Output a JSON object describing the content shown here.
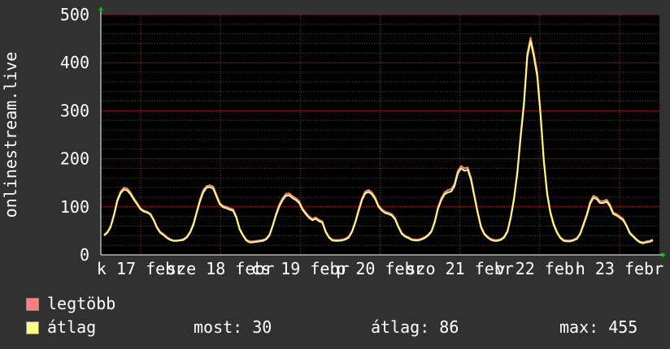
{
  "chart_data": {
    "type": "line",
    "ylabel": "onlinestream.live",
    "ylim": [
      0,
      500
    ],
    "yticks": [
      0,
      100,
      200,
      300,
      400,
      500
    ],
    "x_tick_labels": [
      "k 17 febr",
      "sze 18 febr",
      "cs 19 febr",
      "p 20 febr",
      "szo 21 febr",
      "v 22 febr",
      "h 23 febr"
    ],
    "grid": true,
    "series": [
      {
        "name": "legtöbb",
        "color": "#ff7f7f",
        "values": [
          42,
          48,
          60,
          85,
          115,
          132,
          140,
          138,
          130,
          118,
          108,
          97,
          92,
          90,
          86,
          74,
          58,
          48,
          43,
          37,
          33,
          30,
          30,
          31,
          33,
          38,
          48,
          65,
          90,
          115,
          135,
          143,
          145,
          142,
          125,
          108,
          102,
          100,
          97,
          95,
          80,
          55,
          42,
          32,
          28,
          28,
          29,
          30,
          31,
          34,
          42,
          62,
          85,
          105,
          118,
          127,
          128,
          122,
          118,
          112,
          97,
          88,
          80,
          75,
          78,
          73,
          70,
          50,
          38,
          32,
          31,
          31,
          32,
          34,
          38,
          50,
          70,
          95,
          118,
          132,
          135,
          130,
          120,
          103,
          95,
          90,
          88,
          85,
          77,
          60,
          46,
          40,
          37,
          33,
          32,
          32,
          34,
          37,
          42,
          50,
          70,
          100,
          118,
          130,
          135,
          137,
          148,
          175,
          185,
          180,
          182,
          160,
          125,
          90,
          60,
          45,
          38,
          33,
          31,
          31,
          33,
          38,
          50,
          80,
          120,
          175,
          250,
          320,
          420,
          452,
          420,
          380,
          300,
          200,
          130,
          90,
          65,
          48,
          37,
          31,
          30,
          30,
          32,
          35,
          45,
          65,
          85,
          110,
          123,
          120,
          112,
          112,
          115,
          105,
          88,
          85,
          80,
          75,
          62,
          47,
          40,
          33,
          28,
          26,
          28,
          29,
          32
        ]
      },
      {
        "name": "átlag",
        "color": "#ffff7f",
        "values": [
          40,
          46,
          58,
          82,
          112,
          128,
          136,
          134,
          126,
          115,
          105,
          95,
          90,
          88,
          84,
          72,
          56,
          46,
          41,
          35,
          31,
          29,
          29,
          30,
          31,
          36,
          46,
          62,
          87,
          111,
          130,
          140,
          141,
          138,
          121,
          105,
          99,
          97,
          94,
          92,
          77,
          53,
          40,
          30,
          26,
          26,
          27,
          28,
          29,
          32,
          40,
          60,
          82,
          101,
          114,
          123,
          124,
          118,
          114,
          108,
          94,
          85,
          77,
          72,
          75,
          70,
          67,
          48,
          36,
          30,
          29,
          29,
          30,
          32,
          36,
          48,
          67,
          91,
          114,
          128,
          131,
          126,
          116,
          100,
          92,
          87,
          85,
          82,
          74,
          58,
          44,
          38,
          35,
          31,
          30,
          30,
          32,
          35,
          40,
          48,
          67,
          96,
          114,
          126,
          130,
          132,
          143,
          170,
          180,
          175,
          177,
          155,
          121,
          87,
          57,
          43,
          36,
          31,
          29,
          29,
          31,
          36,
          48,
          77,
          116,
          170,
          244,
          312,
          412,
          445,
          412,
          372,
          292,
          194,
          126,
          87,
          62,
          46,
          35,
          29,
          28,
          28,
          30,
          33,
          43,
          62,
          82,
          106,
          119,
          116,
          108,
          108,
          111,
          101,
          85,
          82,
          77,
          72,
          60,
          45,
          38,
          31,
          26,
          24,
          26,
          27,
          30
        ]
      }
    ],
    "stats": {
      "most": "most: 30",
      "atlag": "átlag: 86",
      "max": "max: 455"
    }
  },
  "colors": {
    "background": "#313131",
    "plot": "#000000",
    "grid": "#4a4a4a",
    "vgrid": "#c02020",
    "axis": "#ffffff"
  }
}
